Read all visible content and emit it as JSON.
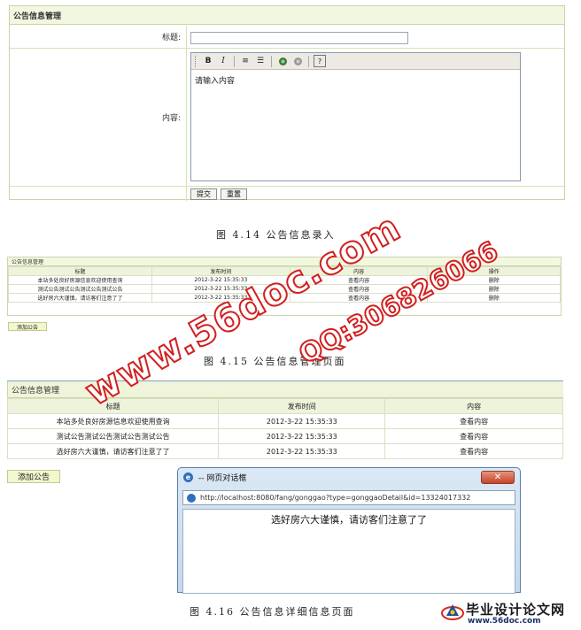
{
  "fig_entry": {
    "header": "公告信息管理",
    "title_label": "标题:",
    "content_label": "内容:",
    "editor_toolbar": [
      "B",
      "I",
      "≡",
      "☰",
      "?"
    ],
    "editor_placeholder": "请输入内容",
    "submit_label": "提交",
    "reset_label": "重置",
    "caption": "图 4.14 公告信息录入"
  },
  "fig_list_small": {
    "header": "公告信息管理",
    "columns": [
      "标题",
      "发布时间",
      "内容",
      "操作"
    ],
    "rows": [
      [
        "本站多处良好房源信息欢迎使用查询",
        "2012-3-22 15:35:33",
        "查看内容",
        "删除"
      ],
      [
        "测试公告测试公告测试公告测试公告",
        "2012-3-22 15:35:33",
        "查看内容",
        "删除"
      ],
      [
        "选好房六大谨慎，请访客们注意了了",
        "2012-3-22 15:35:33",
        "查看内容",
        "删除"
      ]
    ],
    "add_label": "添加公告",
    "caption": "图 4.15 公告信息管理页面"
  },
  "fig_list_large": {
    "header": "公告信息管理",
    "columns": [
      "标题",
      "发布时间",
      "内容"
    ],
    "rows": [
      [
        "本站多处良好房源信息欢迎使用查询",
        "2012-3-22 15:35:33",
        "查看内容"
      ],
      [
        "测试公告测试公告测试公告测试公告",
        "2012-3-22 15:35:33",
        "查看内容"
      ],
      [
        "选好房六大谨慎，请访客们注意了了",
        "2012-3-22 15:35:33",
        "查看内容"
      ]
    ],
    "add_label": "添加公告",
    "caption": "图 4.16 公告信息详细信息页面"
  },
  "dialog": {
    "title": "-- 网页对话框",
    "url": "http://localhost:8080/fang/gonggao?type=gonggaoDetail&id=13324017332",
    "body_text": "选好房六大谨慎，请访客们注意了了"
  },
  "watermark": {
    "site": "www.56doc.com",
    "qq": "QQ:306826066"
  },
  "logo": {
    "text": "毕业设计论文网",
    "url": "www.56doc.com"
  }
}
